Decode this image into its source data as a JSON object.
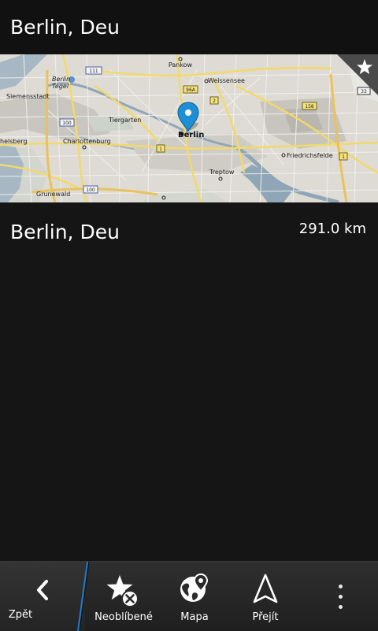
{
  "header": {
    "title": "Berlin, Deu"
  },
  "map": {
    "labels": {
      "pankow": "Pankow",
      "berlin_tegel_1": "Berlin",
      "berlin_tegel_2": "Tegel",
      "weissensee": "Weissensee",
      "siemensstadt": "Siemensstadt",
      "tiergarten": "Tiergarten",
      "berlin": "Berlin",
      "charlottenburg": "Charlottenburg",
      "chelsberg": "helsberg",
      "friedrichsfelde": "Friedrichsfelde",
      "treptow": "Treptow",
      "grunewald": "Grunewald"
    },
    "shields": {
      "s111": "111",
      "s96a": "96A",
      "s2": "2",
      "s158": "158",
      "s33": "33",
      "s100a": "100",
      "s100b": "100",
      "s1a": "1",
      "s1b": "1"
    },
    "pin_color": "#1e8fd5",
    "star_icon": "star-icon"
  },
  "result": {
    "name": "Berlin, Deu",
    "distance": "291.0 km"
  },
  "action_bar": {
    "back_label": "Zpět",
    "unfavorite_label": "Neoblíbené",
    "map_label": "Mapa",
    "go_label": "Přejít",
    "accent_color": "#1a7fd0"
  }
}
